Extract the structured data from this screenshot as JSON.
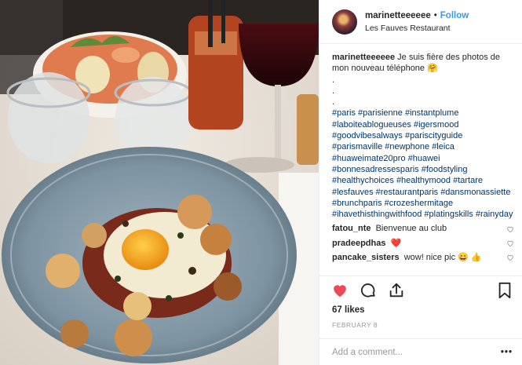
{
  "header": {
    "username": "marinetteeeeee",
    "separator": "•",
    "follow_label": "Follow",
    "location": "Les Fauves Restaurant"
  },
  "caption": {
    "username": "marinetteeeeee",
    "text": "Je suis fière des photos de mon nouveau téléphone 🤗",
    "dots": [
      ".",
      ".",
      "."
    ],
    "hashtags": "#paris #parisienne #instantplume #laboiteablogueuses #igersmood #goodvibesalways #pariscityguide #parismaville #newphone #leica #huaweimate20pro #huawei #bonnesadressesparis #foodstyling #healthychoices #healthymood #tartare #lesfauves #restaurantparis #dansmonassiette #brunchparis #crozeshermitage #ihavethisthingwithfood #platingskills #rainyday"
  },
  "comments": [
    {
      "username": "fatou_nte",
      "text": "Bienvenue au club"
    },
    {
      "username": "pradeepdhas",
      "text": "❤️"
    },
    {
      "username": "pancake_sisters",
      "text": "wow! nice pic 😄 👍"
    }
  ],
  "actions": {
    "like_icon": "heart-icon",
    "comment_icon": "comment-icon",
    "share_icon": "share-icon",
    "save_icon": "bookmark-icon"
  },
  "likes_text": "67 likes",
  "date_text": "February 8",
  "add_comment": {
    "placeholder": "Add a comment...",
    "more": "•••"
  },
  "colors": {
    "link": "#3897f0",
    "hashtag": "#003569",
    "liked_heart": "#ed4956",
    "muted": "#999999"
  }
}
